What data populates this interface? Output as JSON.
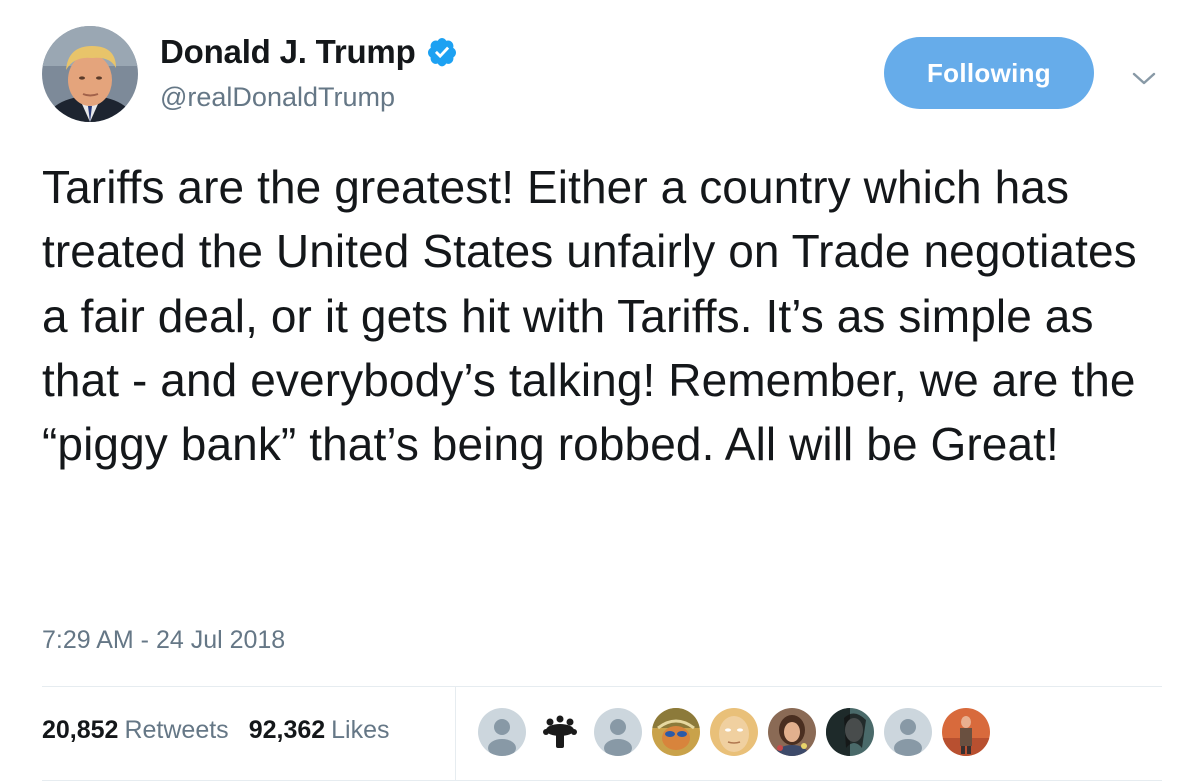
{
  "user": {
    "display_name": "Donald J. Trump",
    "handle": "@realDonaldTrump",
    "verified": true
  },
  "follow_button": {
    "label": "Following"
  },
  "tweet": {
    "text": "Tariffs are the greatest! Either a country which has treated the United States unfairly on Trade negotiates a fair deal, or it gets hit with Tariffs. It’s as simple as that - and everybody’s talking! Remember, we are the “piggy bank” that’s being robbed. All will be Great!",
    "timestamp": "7:29 AM - 24 Jul 2018"
  },
  "stats": {
    "retweets_count": "20,852",
    "retweets_label": "Retweets",
    "likes_count": "92,362",
    "likes_label": "Likes"
  },
  "liked_by_avatars": [
    {
      "type": "default"
    },
    {
      "type": "emblem"
    },
    {
      "type": "default"
    },
    {
      "type": "photo"
    },
    {
      "type": "photo"
    },
    {
      "type": "photo"
    },
    {
      "type": "photo"
    },
    {
      "type": "default"
    },
    {
      "type": "photo"
    }
  ],
  "colors": {
    "accent": "#66acea",
    "verified_blue": "#1da1f2",
    "secondary_text": "#657786",
    "primary_text": "#14171a",
    "divider": "#e6ecf0"
  },
  "icons": {
    "verified": "verified-badge-icon",
    "caret": "chevron-down-icon"
  }
}
